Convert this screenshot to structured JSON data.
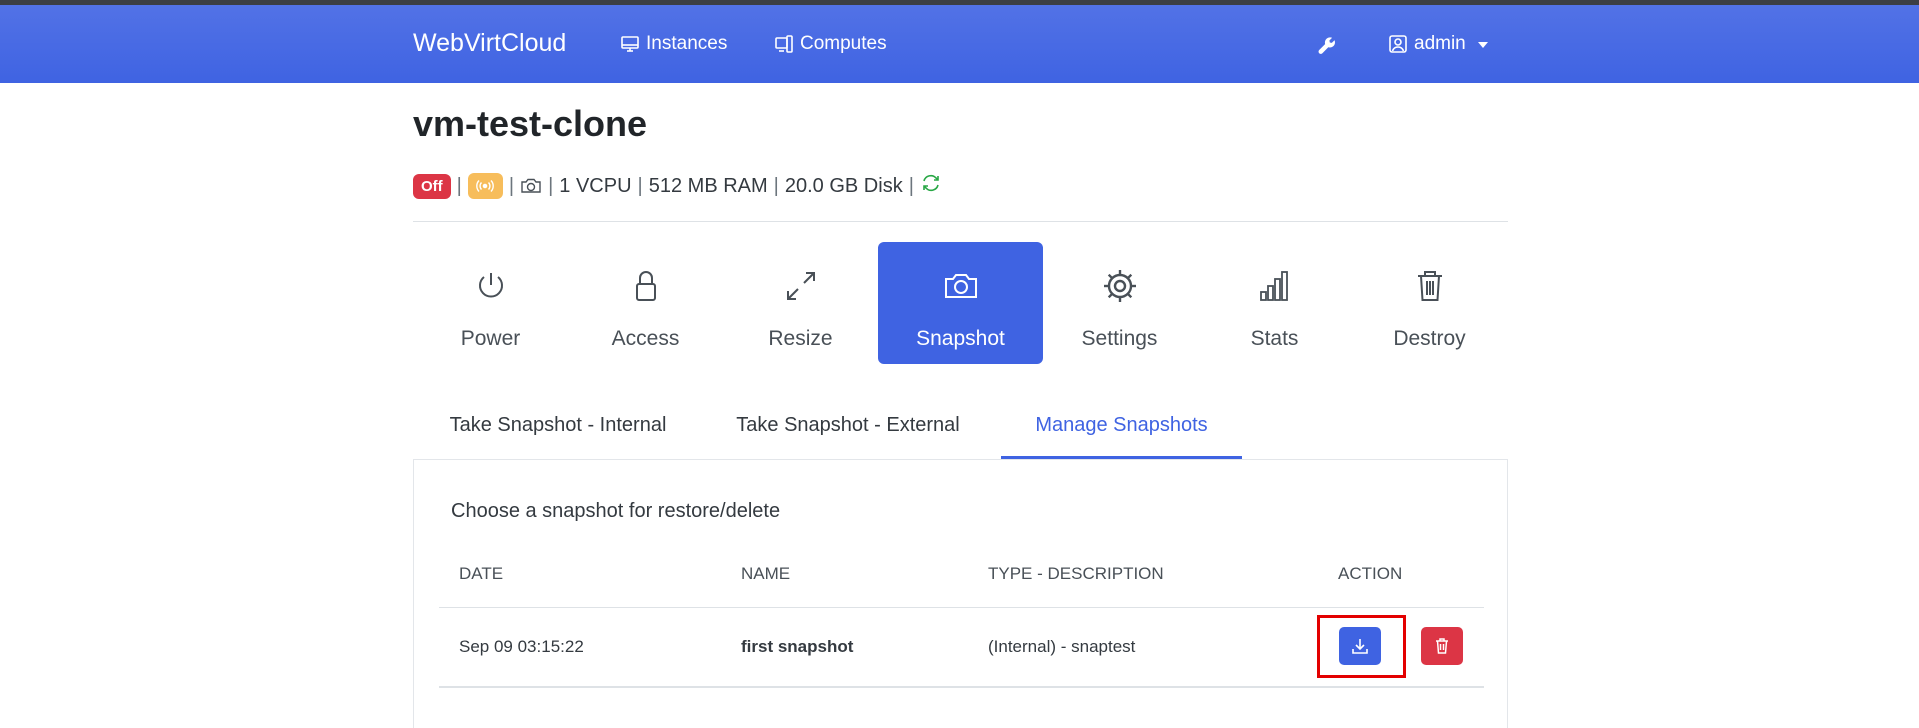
{
  "navbar": {
    "brand": "WebVirtCloud",
    "links": [
      {
        "label": "Instances",
        "icon": "monitor-icon"
      },
      {
        "label": "Computes",
        "icon": "computes-icon"
      }
    ],
    "tools_icon": "wrench-icon",
    "user": {
      "label": "admin",
      "icon": "user-icon"
    }
  },
  "instance": {
    "name": "vm-test-clone",
    "status_badge": "Off",
    "vcpu": "1 VCPU",
    "ram": "512 MB RAM",
    "disk": "20.0 GB Disk"
  },
  "action_tiles": [
    {
      "label": "Power",
      "icon": "power-icon"
    },
    {
      "label": "Access",
      "icon": "lock-icon"
    },
    {
      "label": "Resize",
      "icon": "resize-icon"
    },
    {
      "label": "Snapshot",
      "icon": "camera-icon",
      "active": true
    },
    {
      "label": "Settings",
      "icon": "gear-icon"
    },
    {
      "label": "Stats",
      "icon": "bar-chart-icon"
    },
    {
      "label": "Destroy",
      "icon": "trash-icon"
    }
  ],
  "snapshot_tabs": [
    {
      "label": "Take Snapshot - Internal"
    },
    {
      "label": "Take Snapshot - External"
    },
    {
      "label": "Manage Snapshots",
      "active": true
    }
  ],
  "manage": {
    "heading": "Choose a snapshot for restore/delete",
    "columns": [
      "DATE",
      "NAME",
      "TYPE - DESCRIPTION",
      "ACTION"
    ],
    "rows": [
      {
        "date": "Sep 09 03:15:22",
        "name": "first snapshot",
        "type_description": "(Internal) - snaptest"
      }
    ]
  },
  "colors": {
    "primary": "#3f63e2",
    "danger": "#dc3545",
    "warning": "#f7bd5b",
    "success": "#28a745",
    "highlight": "#e30000"
  }
}
